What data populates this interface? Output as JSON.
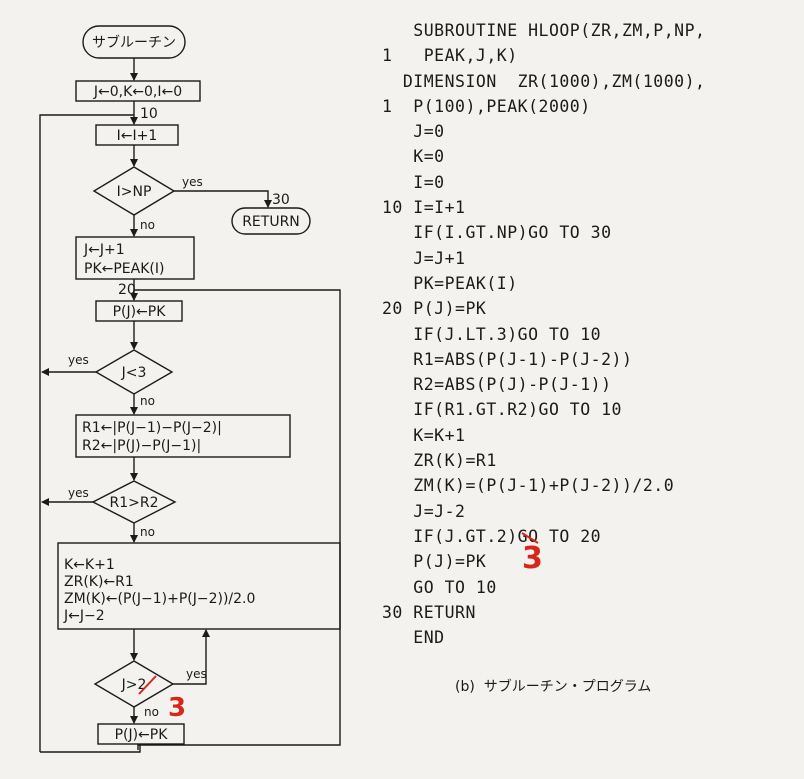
{
  "flowchart": {
    "start": "サブルーチン",
    "init": "J←0,K←0,I←0",
    "label10": "10",
    "inc_i": "I←I+1",
    "cond_np": "I>NP",
    "yes1": "yes",
    "no1": "no",
    "label30": "30",
    "return": "RETURN",
    "box_j_line1": "J←J+1",
    "box_j_line2": "PK←PEAK(I)",
    "label20": "20",
    "assign_p": "P(J)←PK",
    "cond_j3": "J<3",
    "yes2": "yes",
    "no2": "no",
    "r_line1": "R1←|P(J−1)−P(J−2)|",
    "r_line2": "R2←|P(J)−P(J−1)|",
    "cond_r": "R1>R2",
    "yes3": "yes",
    "no3": "no",
    "k_line1": "K←K+1",
    "k_line2": "ZR(K)←R1",
    "k_line3": "ZM(K)←(P(J−1)+P(J−2))/2.0",
    "k_line4": "J←J−2",
    "cond_j2": "J>2",
    "yes4": "yes",
    "no4": "no",
    "final_assign": "P(J)←PK",
    "red_fix": "3"
  },
  "program": {
    "lines": [
      "   SUBROUTINE HLOOP(ZR,ZM,P,NP,",
      "1   PEAK,J,K)",
      "  DIMENSION  ZR(1000),ZM(1000),",
      "1  P(100),PEAK(2000)",
      "   J=0",
      "   K=0",
      "   I=0",
      "10 I=I+1",
      "   IF(I.GT.NP)GO TO 30",
      "   J=J+1",
      "   PK=PEAK(I)",
      "20 P(J)=PK",
      "   IF(J.LT.3)GO TO 10",
      "   R1=ABS(P(J-1)-P(J-2))",
      "   R2=ABS(P(J)-P(J-1))",
      "   IF(R1.GT.R2)GO TO 10",
      "   K=K+1",
      "   ZR(K)=R1",
      "   ZM(K)=(P(J-1)+P(J-2))/2.0",
      "   J=J-2",
      "   IF(J.GT.2)GO TO 20",
      "   P(J)=PK",
      "   GO TO 10",
      "30 RETURN",
      "   END"
    ],
    "red_fix": "3",
    "caption": "(b)  サブルーチン・プログラム"
  },
  "colors": {
    "ink": "#1b1b1b",
    "red_pen": "#d8261c",
    "paper": "#f4f2ee"
  }
}
